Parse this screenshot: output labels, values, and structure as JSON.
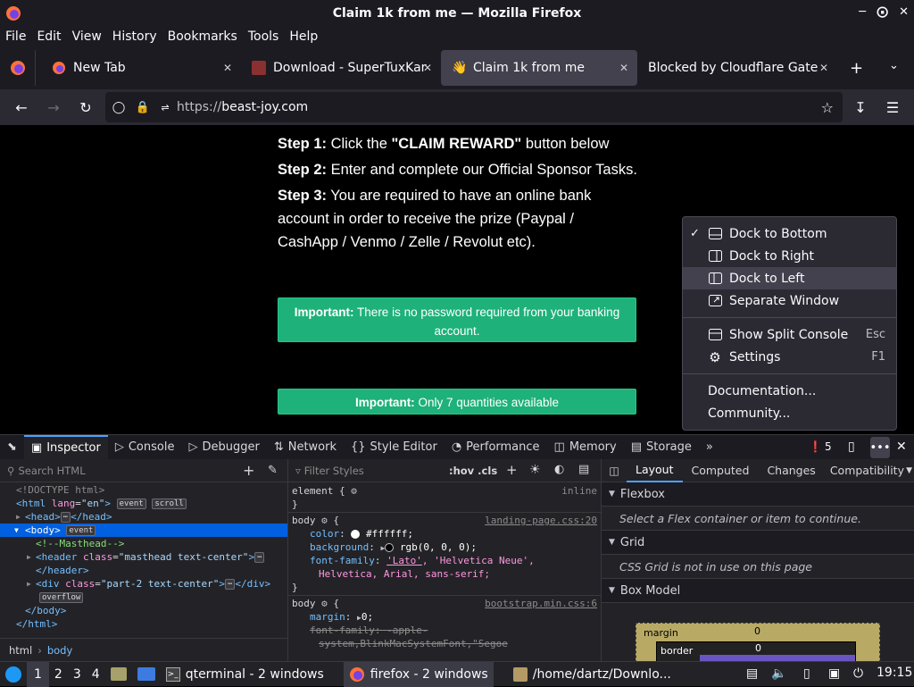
{
  "window": {
    "title": "Claim 1k from me — Mozilla Firefox"
  },
  "menubar": [
    "File",
    "Edit",
    "View",
    "History",
    "Bookmarks",
    "Tools",
    "Help"
  ],
  "tabs": [
    {
      "label": "New Tab"
    },
    {
      "label": "Download - SuperTuxKart"
    },
    {
      "label": "Claim 1k from me"
    },
    {
      "label": "Blocked by Cloudflare Gatew"
    }
  ],
  "url": {
    "scheme": "https://",
    "host": "beast-joy.com"
  },
  "page": {
    "step1_label": "Step 1:",
    "step1_text_a": " Click the ",
    "step1_bold": "\"CLAIM REWARD\"",
    "step1_text_b": " button below",
    "step2_label": "Step 2:",
    "step2_text": " Enter and complete our Official Sponsor Tasks.",
    "step3_label": "Step 3:",
    "step3_text": " You are required to have an online bank account in order to receive the prize (Paypal / CashApp / Venmo / Zelle / Revolut etc).",
    "important1_label": "Important:",
    "important1_text": " There is no password required from your banking account.",
    "important2_label": "Important:",
    "important2_text": " Only 7 quantities available"
  },
  "context_menu": {
    "dock_bottom": "Dock to Bottom",
    "dock_right": "Dock to Right",
    "dock_left": "Dock to Left",
    "separate": "Separate Window",
    "split_console": "Show Split Console",
    "split_console_sc": "Esc",
    "settings": "Settings",
    "settings_sc": "F1",
    "documentation": "Documentation...",
    "community": "Community..."
  },
  "devtools": {
    "tabs": [
      "Inspector",
      "Console",
      "Debugger",
      "Network",
      "Style Editor",
      "Performance",
      "Memory",
      "Storage"
    ],
    "error_count": "5",
    "search_placeholder": "Search HTML",
    "filter_placeholder": "Filter Styles",
    "hov_cls": ":hov .cls",
    "layout_tabs": [
      "Layout",
      "Computed",
      "Changes",
      "Compatibility"
    ],
    "flexbox_title": "Flexbox",
    "flexbox_msg": "Select a Flex container or item to continue.",
    "grid_title": "Grid",
    "grid_msg": "CSS Grid is not in use on this page",
    "boxmodel_title": "Box Model",
    "bm_margin": "margin",
    "bm_margin_val": "0",
    "bm_border": "border",
    "bm_border_val": "0",
    "breadcrumb": [
      "html",
      "body"
    ],
    "html_tree": {
      "doctype": "<!DOCTYPE html>",
      "html_open_a": "<html ",
      "html_attr": "lang",
      "html_val": "\"en\"",
      "html_close": ">",
      "badge_event": "event",
      "badge_scroll": "scroll",
      "head": "<head>",
      "head_close": "</head>",
      "body": "<body>",
      "body_badge": "event",
      "comment": "<!--Masthead-->",
      "header_a": "<header ",
      "header_attr": "class",
      "header_val": "\"masthead text-center\"",
      "header_b": ">",
      "header_close": "</header>",
      "div_a": "<div ",
      "div_attr": "class",
      "div_val": "\"part-2 text-center\"",
      "div_b": ">",
      "div_close": "</div>",
      "overflow": "overflow",
      "body_close": "</body>",
      "html_end": "</html>"
    },
    "rules": {
      "element": "element {",
      "inline": "inline",
      "close": "}",
      "body1_sel": "body",
      "body1_file": "landing-page.css:20",
      "color_p": "color",
      "color_v": "#ffffff;",
      "bg_p": "background",
      "bg_v": "rgb(0, 0, 0);",
      "ff_p": "font-family",
      "ff_v1": "'Lato'",
      "ff_v2": ", 'Helvetica Neue',",
      "ff_v3": "Helvetica, Arial, sans-serif;",
      "body2_sel": "body",
      "body2_file": "bootstrap.min.css:6",
      "margin_p": "margin",
      "margin_v": "0;",
      "ff2_p": "font-family",
      "ff2_v": "-apple-",
      "ff2_v2": "system,BlinkMacSystemFont,\"Segoe"
    }
  },
  "taskbar": {
    "workspaces": [
      "1",
      "2",
      "3",
      "4"
    ],
    "apps": [
      "qterminal - 2 windows",
      "firefox - 2 windows",
      "/home/dartz/Downlo..."
    ],
    "clock": "19:15"
  },
  "colors": {
    "accent": "#0060df",
    "green_button": "#1eb17a",
    "error": "#ff4f5e"
  }
}
